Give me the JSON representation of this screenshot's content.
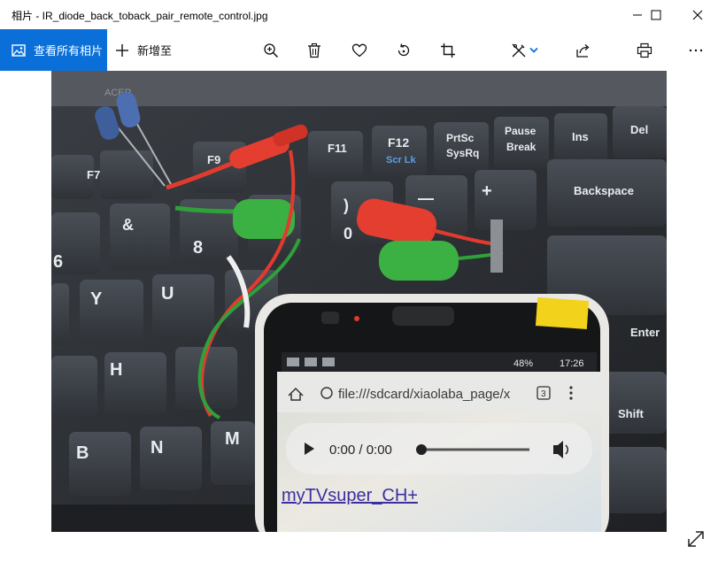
{
  "window": {
    "title": "相片 - IR_diode_back_toback_pair_remote_control.jpg",
    "minimize_icon": "minimize-icon",
    "maximize_icon": "maximize-icon",
    "close_icon": "close-icon"
  },
  "toolbar": {
    "all_photos_label": "查看所有相片",
    "add_to_label": "新增至",
    "accent_color": "#0a6fd8",
    "icons": [
      "zoom-in-icon",
      "delete-icon",
      "favorite-icon",
      "rotate-icon",
      "crop-icon",
      "edit-icon",
      "share-icon",
      "print-icon",
      "more-icon"
    ]
  },
  "photo": {
    "keys": {
      "f12": "F12",
      "scrlk": "Scr Lk",
      "prtsc": "PrtSc",
      "sysrq": "SysRq",
      "pause": "Pause",
      "brk": "Break",
      "ins": "Ins",
      "del": "Del",
      "f11": "F11",
      "f9": "F9",
      "f7": "F7",
      "backspace": "Backspace",
      "enter": "Enter",
      "shift": "Shift",
      "plus": "+",
      "minus": "—",
      "paren": ")",
      "amp": "&",
      "six": "6",
      "eight": "8",
      "zero": "0",
      "y": "Y",
      "u": "U",
      "h": "H",
      "b": "B",
      "n": "N",
      "m": "M",
      "kb_brand": "ACER"
    },
    "phone": {
      "battery": "48%",
      "time": "17:26",
      "url": "file:///sdcard/xiaolaba_page/x",
      "tab_count": "3",
      "audio_time": "0:00 / 0:00",
      "audio_progress": 0,
      "link_text": "myTVsuper_CH+"
    }
  },
  "viewer": {
    "expand_icon": "expand-icon"
  }
}
